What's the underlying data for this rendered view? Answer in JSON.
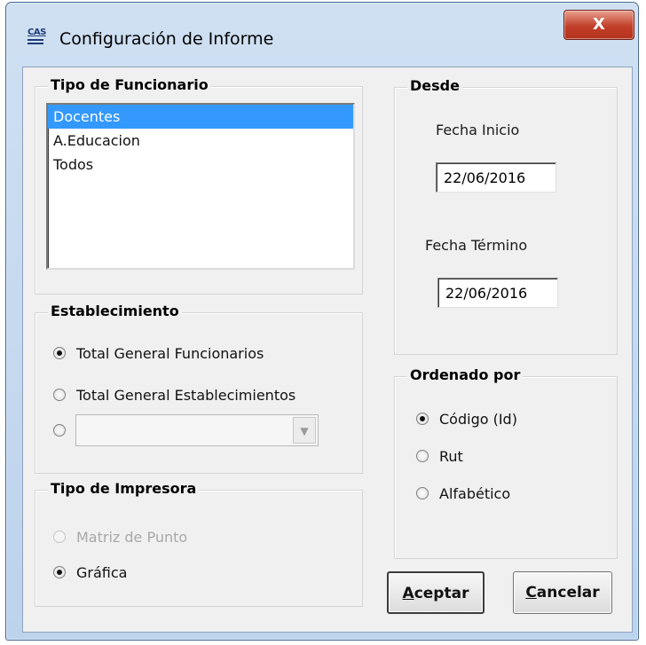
{
  "window": {
    "title": "Configuración de Informe",
    "icon_text": "CAS",
    "close_glyph": "X"
  },
  "tipo_funcionario": {
    "legend": "Tipo de Funcionario",
    "items": [
      {
        "label": "Docentes",
        "selected": true
      },
      {
        "label": "A.Educacion",
        "selected": false
      },
      {
        "label": "Todos",
        "selected": false
      }
    ]
  },
  "establecimiento": {
    "legend": "Establecimiento",
    "options": [
      {
        "label": "Total General Funcionarios",
        "checked": true
      },
      {
        "label": "Total General Establecimientos",
        "checked": false
      }
    ],
    "combo_value": ""
  },
  "tipo_impresora": {
    "legend": "Tipo de Impresora",
    "options": [
      {
        "label": "Matriz de Punto",
        "checked": false,
        "disabled": true
      },
      {
        "label": "Gráfica",
        "checked": true,
        "disabled": false
      }
    ]
  },
  "desde": {
    "legend": "Desde",
    "fecha_inicio_label": "Fecha Inicio",
    "fecha_inicio_value": "22/06/2016",
    "fecha_termino_label": "Fecha Término",
    "fecha_termino_value": "22/06/2016"
  },
  "ordenado_por": {
    "legend": "Ordenado por",
    "options": [
      {
        "label": "Código (Id)",
        "checked": true
      },
      {
        "label": "Rut",
        "checked": false
      },
      {
        "label": "Alfabético",
        "checked": false
      }
    ]
  },
  "buttons": {
    "aceptar_mnemonic": "A",
    "aceptar_rest": "ceptar",
    "cancelar_mnemonic": "C",
    "cancelar_rest": "ancelar"
  },
  "colors": {
    "selection": "#3399ff",
    "close_button": "#c2402a",
    "dialog_bg": "#f0f0f0"
  }
}
